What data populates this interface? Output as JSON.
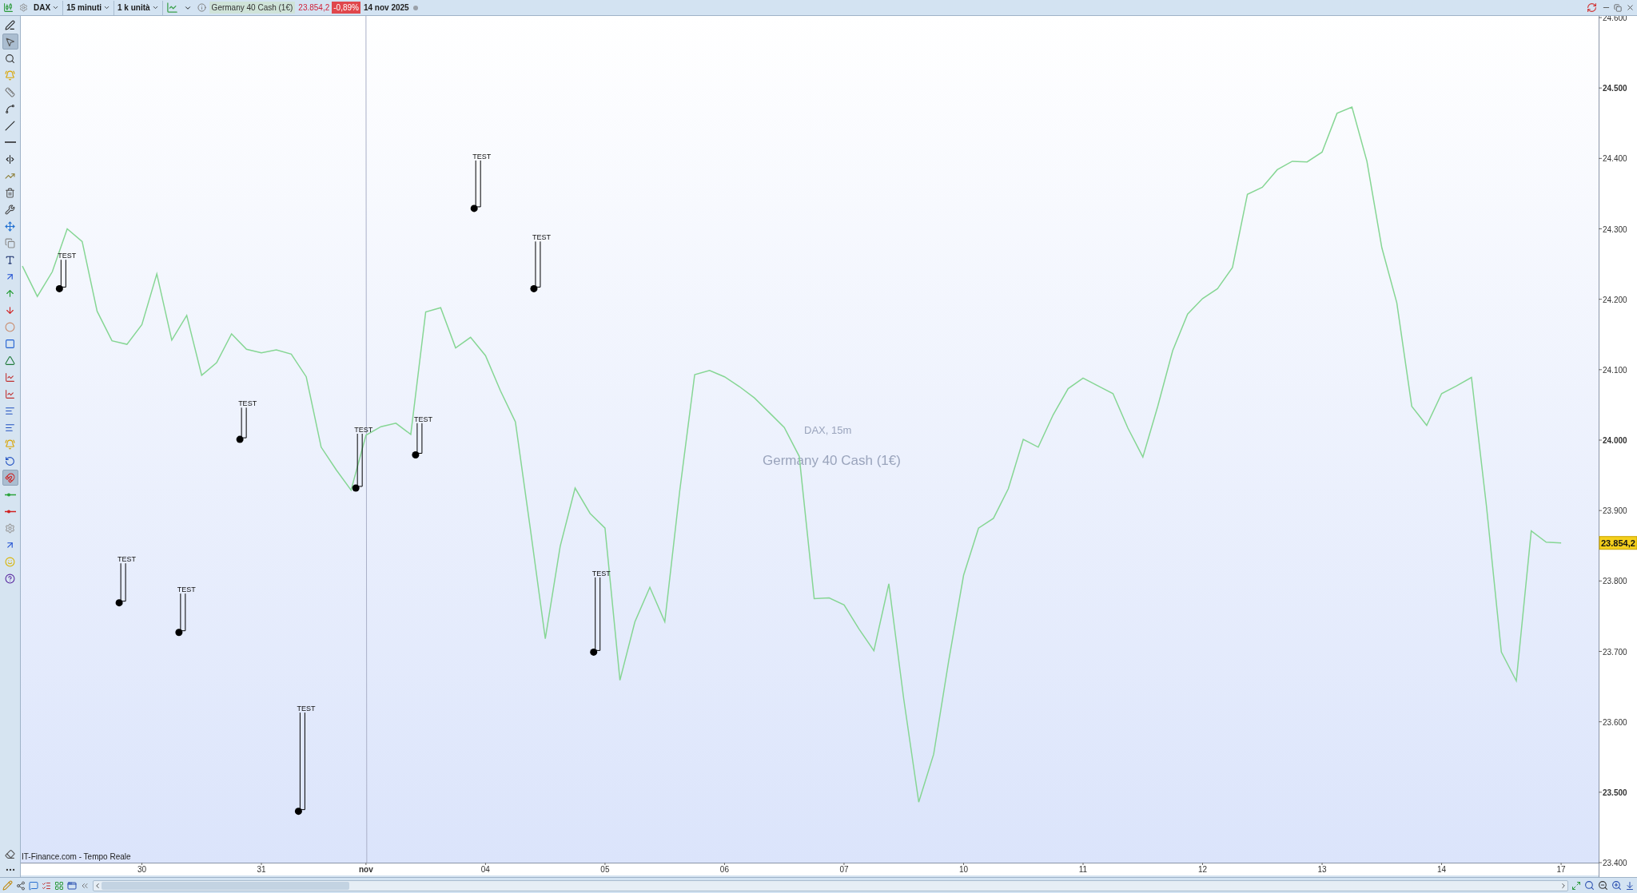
{
  "toolbar": {
    "symbol": "DAX",
    "timeframe": "15 minuti",
    "units": "1 k unità",
    "instrument": "Germany 40 Cash (1€)",
    "price": "23.854,2",
    "change": "-0,89%",
    "date": "14 nov 2025"
  },
  "drawing_tools": [
    {
      "kind": "pencil",
      "selected": false
    },
    {
      "kind": "pointer",
      "selected": true
    },
    {
      "kind": "zoom",
      "selected": false
    },
    {
      "kind": "alert",
      "selected": false
    },
    {
      "kind": "ruler",
      "selected": false
    },
    {
      "kind": "segment",
      "selected": false
    },
    {
      "kind": "diagonal",
      "selected": false
    },
    {
      "kind": "horizontal",
      "selected": false
    },
    {
      "kind": "vertical",
      "selected": false
    },
    {
      "kind": "trend",
      "selected": false
    },
    {
      "kind": "trash",
      "selected": false
    },
    {
      "kind": "wrench",
      "selected": false
    },
    {
      "kind": "move",
      "selected": false
    },
    {
      "kind": "copy",
      "selected": false
    },
    {
      "kind": "text",
      "selected": false
    },
    {
      "kind": "arrow",
      "selected": false
    },
    {
      "kind": "up",
      "selected": false
    },
    {
      "kind": "down",
      "selected": false
    },
    {
      "kind": "ellipse",
      "selected": false
    },
    {
      "kind": "rectangle",
      "selected": false
    },
    {
      "kind": "triangle",
      "selected": false
    },
    {
      "kind": "chart",
      "selected": false
    },
    {
      "kind": "chart",
      "selected": false
    },
    {
      "kind": "lines",
      "selected": false
    },
    {
      "kind": "lines",
      "selected": false
    },
    {
      "kind": "alert",
      "selected": false
    },
    {
      "kind": "undo",
      "selected": false
    },
    {
      "kind": "magnet",
      "selected": true
    },
    {
      "kind": "greenline",
      "selected": false
    },
    {
      "kind": "redline",
      "selected": false
    },
    {
      "kind": "settings",
      "selected": false
    },
    {
      "kind": "arrow",
      "selected": false
    },
    {
      "kind": "smile",
      "selected": false
    },
    {
      "kind": "help",
      "selected": false
    }
  ],
  "chart": {
    "watermark_symbol": "DAX, 15m",
    "watermark_name": "Germany 40 Cash (1€)",
    "source": "IT-Finance.com - Tempo Reale",
    "current_price_label": "23.854,2",
    "test_markers": [
      {
        "text": "TEST"
      },
      {
        "text": "TEST"
      },
      {
        "text": "TEST"
      },
      {
        "text": "TEST"
      },
      {
        "text": "TEST"
      },
      {
        "text": "TEST"
      },
      {
        "text": "TEST"
      },
      {
        "text": "TEST"
      },
      {
        "text": "TEST"
      },
      {
        "text": "TEST"
      }
    ],
    "chart_data": {
      "type": "line",
      "ylim": [
        23400,
        24600
      ],
      "yticks": [
        {
          "value": 23400,
          "label": "23.400"
        },
        {
          "value": 23500,
          "label": "23.500"
        },
        {
          "value": 23600,
          "label": "23.600"
        },
        {
          "value": 23700,
          "label": "23.700"
        },
        {
          "value": 23800,
          "label": "23.800"
        },
        {
          "value": 23900,
          "label": "23.900"
        },
        {
          "value": 24000,
          "label": "24.000"
        },
        {
          "value": 24100,
          "label": "24.100"
        },
        {
          "value": 24200,
          "label": "24.200"
        },
        {
          "value": 24300,
          "label": "24.300"
        },
        {
          "value": 24400,
          "label": "24.400"
        },
        {
          "value": 24500,
          "label": "24.500"
        },
        {
          "value": 24600,
          "label": "24.600"
        }
      ],
      "categories": [
        null,
        null,
        null,
        null,
        null,
        null,
        null,
        null,
        "30",
        null,
        null,
        null,
        null,
        null,
        null,
        null,
        "31",
        null,
        null,
        null,
        null,
        null,
        null,
        "nov",
        null,
        null,
        null,
        null,
        null,
        null,
        null,
        "04",
        null,
        null,
        null,
        null,
        null,
        null,
        null,
        "05",
        null,
        null,
        null,
        null,
        null,
        null,
        null,
        "06",
        null,
        null,
        null,
        null,
        null,
        null,
        null,
        "07",
        null,
        null,
        null,
        null,
        null,
        null,
        null,
        "10",
        null,
        null,
        null,
        null,
        null,
        null,
        null,
        "11",
        null,
        null,
        null,
        null,
        null,
        null,
        null,
        "12",
        null,
        null,
        null,
        null,
        null,
        null,
        null,
        "13",
        null,
        null,
        null,
        null,
        null,
        null,
        null,
        "14",
        null,
        null,
        null,
        null,
        null,
        null,
        null,
        "17"
      ],
      "series": [
        {
          "color": "#86d694",
          "values": [
            24247,
            24204,
            24239,
            24300,
            24282,
            24183,
            24141,
            24136,
            24164,
            24236,
            24142,
            24177,
            24092,
            24110,
            24151,
            24129,
            24124,
            24128,
            24122,
            24090,
            23990,
            23958,
            23929,
            24007,
            24019,
            24024,
            24008,
            24182,
            24188,
            24131,
            24146,
            24120,
            24070,
            24026,
            23874,
            23718,
            23849,
            23932,
            23896,
            23875,
            23659,
            23742,
            23791,
            23742,
            23928,
            24093,
            24099,
            24090,
            24076,
            24060,
            24039,
            24018,
            23977,
            23775,
            23776,
            23766,
            23732,
            23701,
            23796,
            23632,
            23486,
            23554,
            23686,
            23808,
            23875,
            23889,
            23931,
            24001,
            23990,
            24036,
            24073,
            24088,
            24077,
            24066,
            24017,
            23976,
            24048,
            24127,
            24179,
            24201,
            24215,
            24245,
            24349,
            24359,
            24384,
            24396,
            24395,
            24409,
            24464,
            24473,
            24396,
            24273,
            24195,
            24048,
            24021,
            24066,
            24077,
            24089,
            23907,
            23699,
            23658,
            23871,
            23855,
            23854
          ]
        }
      ]
    }
  }
}
